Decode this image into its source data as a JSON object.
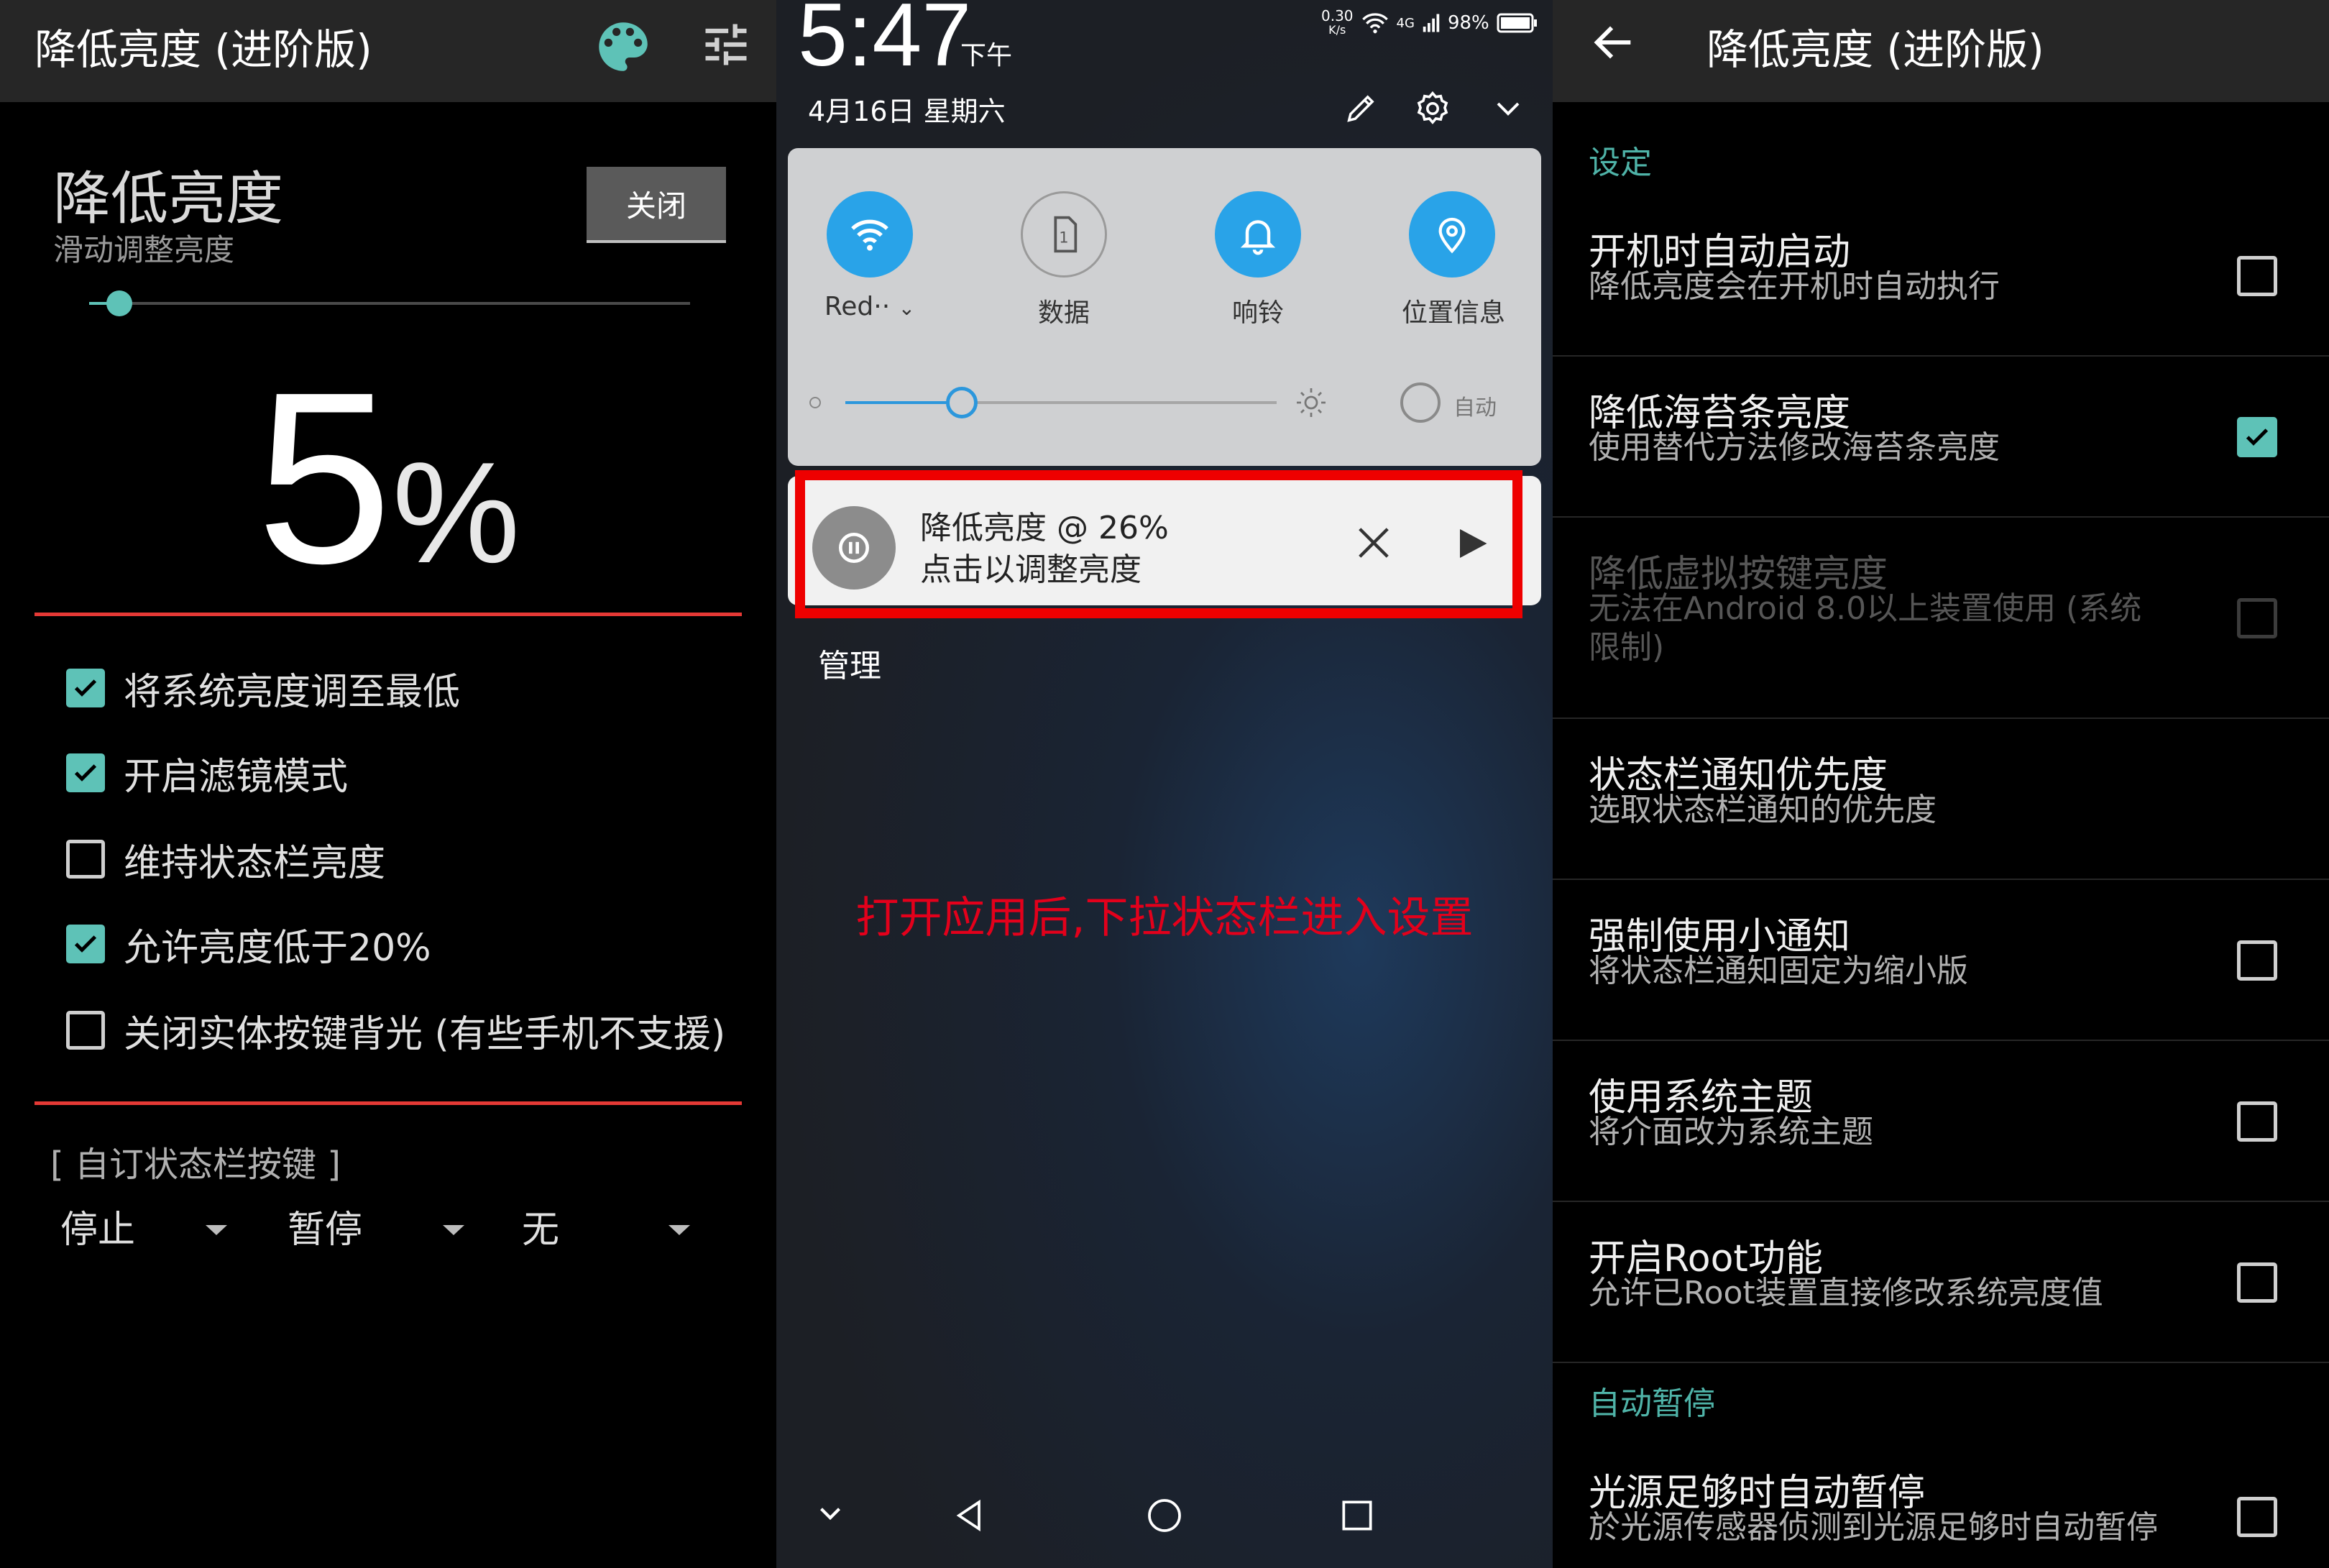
{
  "colors": {
    "accent": "#5ec2b7",
    "highlight_red": "#e53935",
    "caption_red": "#e3001b",
    "qs_blue": "#29a3e8"
  },
  "left": {
    "app_title": "降低亮度 (进阶版)",
    "header_icons": [
      "palette-icon",
      "tune-icon"
    ],
    "title": "降低亮度",
    "subtitle": "滑动调整亮度",
    "close_label": "关闭",
    "slider_fraction": 0.05,
    "percent_value": "5",
    "percent_sign": "%",
    "options": [
      {
        "label": "将系统亮度调至最低",
        "checked": true
      },
      {
        "label": "开启滤镜模式",
        "checked": true
      },
      {
        "label": "维持状态栏亮度",
        "checked": false
      },
      {
        "label": "允许亮度低于20%",
        "checked": true
      },
      {
        "label": "关闭实体按键背光 (有些手机不支援)",
        "checked": false
      }
    ],
    "custom_section": "[ 自订状态栏按键 ]",
    "spinners": [
      "停止",
      "暂停",
      "无"
    ]
  },
  "middle": {
    "time": "5:47",
    "ampm": "下午",
    "status": {
      "speed": "0.30",
      "speed_unit": "K/s",
      "network": "4G",
      "battery": "98%"
    },
    "date": "4月16日 星期六",
    "header_icons": [
      "edit-icon",
      "settings-icon",
      "chevron-down-icon"
    ],
    "tiles": [
      {
        "label": "Red··",
        "icon": "wifi-icon",
        "active": true
      },
      {
        "label": "数据",
        "icon": "sim-card-icon",
        "active": false
      },
      {
        "label": "响铃",
        "icon": "bell-icon",
        "active": true
      },
      {
        "label": "位置信息",
        "icon": "location-icon",
        "active": true
      }
    ],
    "brightness_fraction": 0.27,
    "auto_label": "自动",
    "notification": {
      "title": "降低亮度 @ 26%",
      "text": "点击以调整亮度"
    },
    "manage_label": "管理",
    "caption": "打开应用后,下拉状态栏进入设置"
  },
  "right": {
    "app_title": "降低亮度 (进阶版)",
    "sections": [
      {
        "category": "设定",
        "items": [
          {
            "title": "开机时自动启动",
            "summary": "降低亮度会在开机时自动执行",
            "checkbox": "off"
          },
          {
            "title": "降低海苔条亮度",
            "summary": "使用替代方法修改海苔条亮度",
            "checkbox": "on"
          },
          {
            "title": "降低虚拟按键亮度",
            "summary": "无法在Android 8.0以上装置使用 (系统限制)",
            "checkbox": "disabled"
          },
          {
            "title": "状态栏通知优先度",
            "summary": "选取状态栏通知的优先度",
            "checkbox": "none"
          },
          {
            "title": "强制使用小通知",
            "summary": "将状态栏通知固定为缩小版",
            "checkbox": "off"
          },
          {
            "title": "使用系统主题",
            "summary": "将介面改为系统主题",
            "checkbox": "off"
          },
          {
            "title": "开启Root功能",
            "summary": "允许已Root装置直接修改系统亮度值",
            "checkbox": "off"
          }
        ]
      },
      {
        "category": "自动暂停",
        "items": [
          {
            "title": "光源足够时自动暂停",
            "summary": "於光源传感器侦测到光源足够时自动暂停",
            "checkbox": "off"
          }
        ]
      }
    ]
  }
}
